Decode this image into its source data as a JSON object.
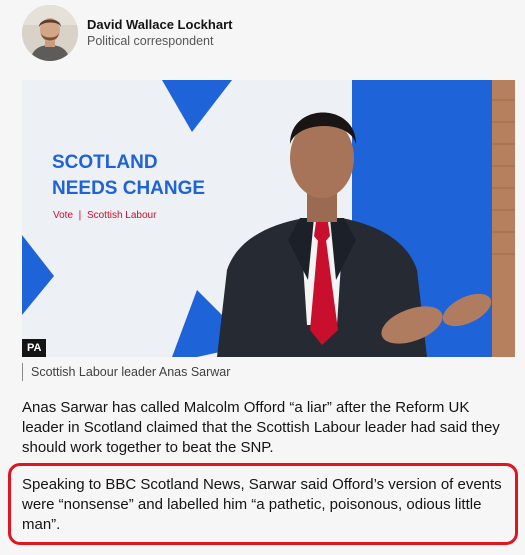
{
  "byline": {
    "author_name": "David Wallace Lockhart",
    "author_role": "Political correspondent"
  },
  "figure": {
    "sign_line1": "SCOTLAND",
    "sign_line2": "NEEDS CHANGE",
    "sign_tagline": "Vote ❘ Scottish Labour",
    "credit": "PA",
    "caption": "Scottish Labour leader Anas Sarwar"
  },
  "article": {
    "paragraph1": "Anas Sarwar has called Malcolm Offord “a liar” after the Reform UK leader in Scotland claimed that the Scottish Labour leader had said they should work together to beat the SNP.",
    "paragraph2": "Speaking to BBC Scotland News, Sarwar said Offord’s version of events were “nonsense” and labelled him “a pathetic, poisonous, odious little man”."
  },
  "colors": {
    "highlight_border": "#e0151f",
    "sign_blue": "#1f63d8",
    "tie_red": "#c8102e"
  }
}
